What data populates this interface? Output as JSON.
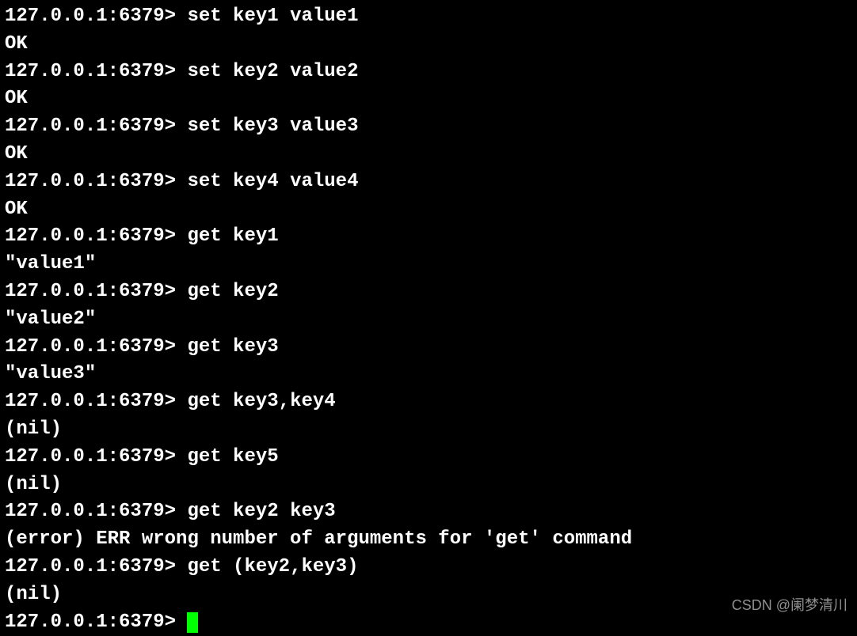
{
  "terminal": {
    "prompt": "127.0.0.1:6379>",
    "lines": [
      {
        "type": "cmd",
        "command": "set key1 value1"
      },
      {
        "type": "out",
        "text": "OK"
      },
      {
        "type": "cmd",
        "command": "set key2 value2"
      },
      {
        "type": "out",
        "text": "OK"
      },
      {
        "type": "cmd",
        "command": "set key3 value3"
      },
      {
        "type": "out",
        "text": "OK"
      },
      {
        "type": "cmd",
        "command": "set key4 value4"
      },
      {
        "type": "out",
        "text": "OK"
      },
      {
        "type": "cmd",
        "command": "get key1"
      },
      {
        "type": "out",
        "text": "\"value1\""
      },
      {
        "type": "cmd",
        "command": "get key2"
      },
      {
        "type": "out",
        "text": "\"value2\""
      },
      {
        "type": "cmd",
        "command": "get key3"
      },
      {
        "type": "out",
        "text": "\"value3\""
      },
      {
        "type": "cmd",
        "command": "get key3,key4"
      },
      {
        "type": "out",
        "text": "(nil)"
      },
      {
        "type": "cmd",
        "command": "get key5"
      },
      {
        "type": "out",
        "text": "(nil)"
      },
      {
        "type": "cmd",
        "command": "get key2 key3"
      },
      {
        "type": "out",
        "text": "(error) ERR wrong number of arguments for 'get' command"
      },
      {
        "type": "cmd",
        "command": "get (key2,key3)"
      },
      {
        "type": "out",
        "text": "(nil)"
      },
      {
        "type": "cursor",
        "command": ""
      }
    ]
  },
  "watermark": "CSDN @阑梦清川"
}
